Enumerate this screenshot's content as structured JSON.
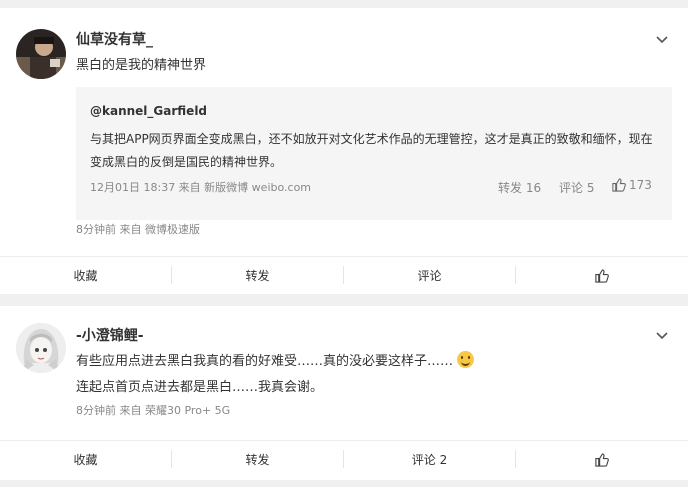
{
  "posts": [
    {
      "username": "仙草没有草_",
      "content": [
        "黑白的是我的精神世界"
      ],
      "meta": "8分钟前  来自 微博极速版",
      "repost": {
        "author": "@kannel_Garfield",
        "lines": [
          "与其把APP网页界面全变成黑白，还不如放开对文化艺术作品的无理管控，这才是真正的致敬和缅怀，现在",
          "变成黑白的反倒是国民的精神世界。"
        ],
        "meta": "12月01日 18:37 来自 新版微博 weibo.com",
        "repost_count": "转发 16",
        "comment_count": "评论 5",
        "like_count": "173"
      },
      "actions": {
        "collect": "收藏",
        "repost": "转发",
        "comment": "评论"
      }
    },
    {
      "username": "-小澄锦鲤-",
      "content": [
        "有些应用点进去黑白我真的看的好难受……真的没必要这样子……",
        "连起点首页点进去都是黑白……我真会谢。"
      ],
      "meta": "8分钟前  来自 荣耀30 Pro+ 5G",
      "actions": {
        "collect": "收藏",
        "repost": "转发",
        "comment": "评论 2"
      }
    }
  ],
  "icons": {
    "more": "chevron-down-icon",
    "like": "thumbs-up-icon",
    "emoji": "smile-emoji-icon"
  }
}
